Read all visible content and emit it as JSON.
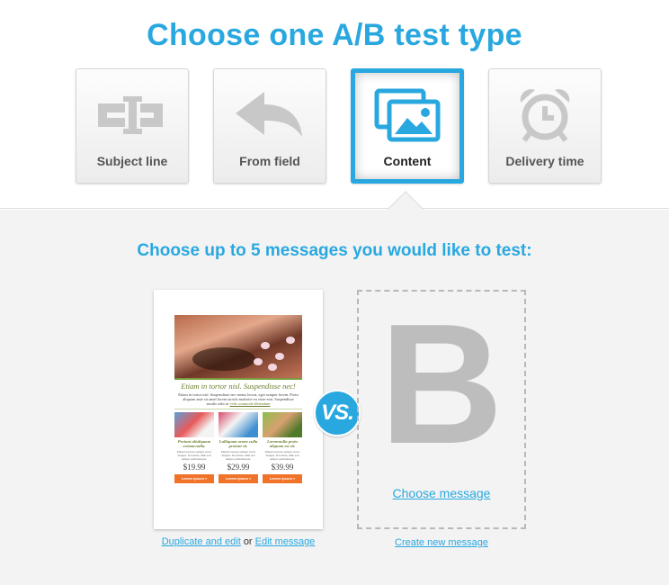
{
  "header": {
    "title": "Choose one A/B test type"
  },
  "test_types": [
    {
      "label": "Subject line",
      "icon": "subject-line-icon",
      "selected": false
    },
    {
      "label": "From field",
      "icon": "reply-arrow-icon",
      "selected": false
    },
    {
      "label": "Content",
      "icon": "images-icon",
      "selected": true
    },
    {
      "label": "Delivery time",
      "icon": "alarm-clock-icon",
      "selected": false
    }
  ],
  "messages": {
    "heading": "Choose up to 5 messages you would like to test:",
    "vs_label": "VS.",
    "message_a": {
      "preview": {
        "headline": "Etiam in tortor nisl. Suspendisse nec!",
        "body": "Etiam in tortor nisl. Suspendisse nec metus lectus, eget semper lorem. Proin aliquam ante sit amet lorem iaculis molestie eu vitae erat. Suspendisse iaculis odio ut",
        "body_link": "velit commodo bibendum",
        "products": [
          {
            "name": "Proiunt aliuliquam eremacnulla.",
            "desc": "Mauris laoreet semper est ut feugiat. In lacinia, nibh sed tempor pellentesque.",
            "price": "$19.99",
            "button": "Lorem ipsum »"
          },
          {
            "name": "Lulliquam ornea culla proiunt sit.",
            "desc": "Mauris laoreet semper est ut feugiat. In lacinia, nibh sed tempor pellentesque.",
            "price": "$29.99",
            "button": "Lorem ipsum »"
          },
          {
            "name": "Loremnulla proin aliquam est sit.",
            "desc": "Mauris laoreet semper est ut feugiat. In lacinia, nibh sed tempor pellentesque.",
            "price": "$39.99",
            "button": "Lorem ipsum »"
          }
        ]
      },
      "duplicate_link": "Duplicate and edit",
      "or_text": "or",
      "edit_link": "Edit message"
    },
    "message_b": {
      "placeholder_letter": "B",
      "choose_link": "Choose message",
      "create_link": "Create new message"
    }
  },
  "colors": {
    "accent": "#29a8e0",
    "icon_grey": "#c8c8c8",
    "button_orange": "#f0732a",
    "product_green": "#6a7f2e"
  }
}
